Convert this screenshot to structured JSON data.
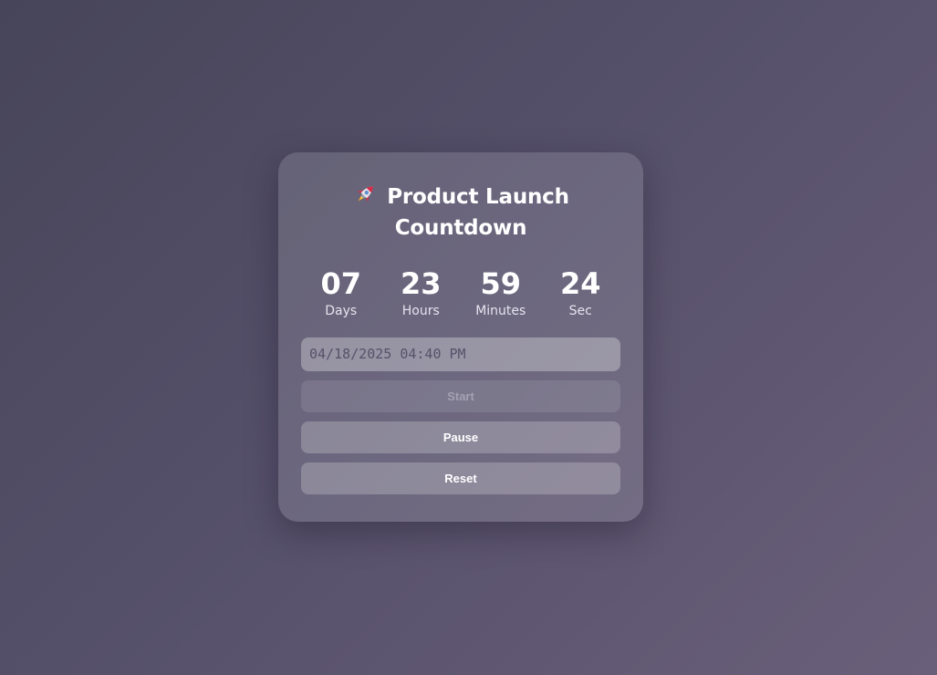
{
  "card": {
    "title_line1": "Product Launch",
    "title_line2": "Countdown",
    "title_icon": "rocket-icon"
  },
  "countdown": [
    {
      "value": "07",
      "label": "Days"
    },
    {
      "value": "23",
      "label": "Hours"
    },
    {
      "value": "59",
      "label": "Minutes"
    },
    {
      "value": "24",
      "label": "Sec"
    }
  ],
  "datetime_input": {
    "value": "04/18/2025 04:40 PM"
  },
  "buttons": {
    "start": "Start",
    "pause": "Pause",
    "reset": "Reset"
  },
  "colors": {
    "background_start": "#474559",
    "background_end": "#6a5f7a",
    "text": "#ffffff"
  }
}
